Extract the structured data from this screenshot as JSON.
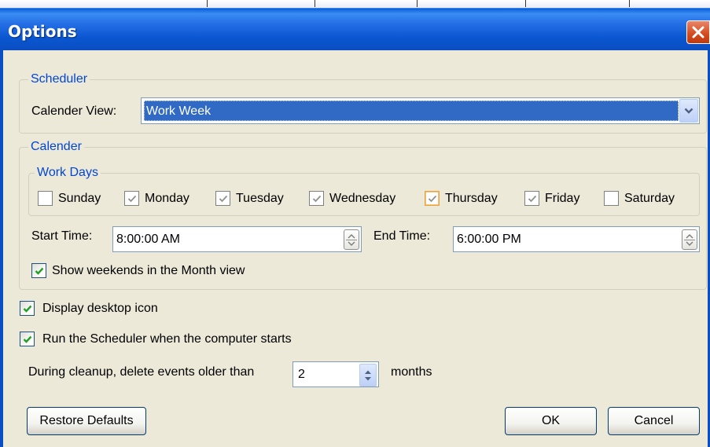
{
  "window": {
    "title": "Options"
  },
  "scheduler": {
    "legend": "Scheduler",
    "calendar_view_label": "Calender View:",
    "calendar_view_value": "Work Week"
  },
  "calendar": {
    "legend": "Calender",
    "work_days": {
      "legend": "Work Days",
      "days": [
        {
          "label": "Sunday",
          "checked": false
        },
        {
          "label": "Monday",
          "checked": true
        },
        {
          "label": "Tuesday",
          "checked": true
        },
        {
          "label": "Wednesday",
          "checked": true
        },
        {
          "label": "Thursday",
          "checked": true
        },
        {
          "label": "Friday",
          "checked": true
        },
        {
          "label": "Saturday",
          "checked": false
        }
      ]
    },
    "start_time_label": "Start Time:",
    "start_time_value": "8:00:00 AM",
    "end_time_label": "End Time:",
    "end_time_value": "6:00:00 PM",
    "show_weekends_label": "Show weekends in the Month view",
    "show_weekends_checked": true
  },
  "options": {
    "display_desktop_icon_label": "Display desktop icon",
    "display_desktop_icon_checked": true,
    "run_scheduler_label": "Run the Scheduler when the computer starts",
    "run_scheduler_checked": true,
    "cleanup_label": "During cleanup, delete events older than",
    "cleanup_value": "2",
    "cleanup_unit": "months"
  },
  "buttons": {
    "restore_defaults": "Restore Defaults",
    "ok": "OK",
    "cancel": "Cancel"
  },
  "icons": {
    "close": "close-icon",
    "dropdown": "chevron-down-icon",
    "check": "check-icon",
    "spin": "spin-updown-icon"
  },
  "colors": {
    "title_bar": "#0a56d0",
    "legend_text": "#0046d5",
    "selection": "#316ac5",
    "dialog_bg": "#ece9d8",
    "check_green": "#21a121"
  }
}
